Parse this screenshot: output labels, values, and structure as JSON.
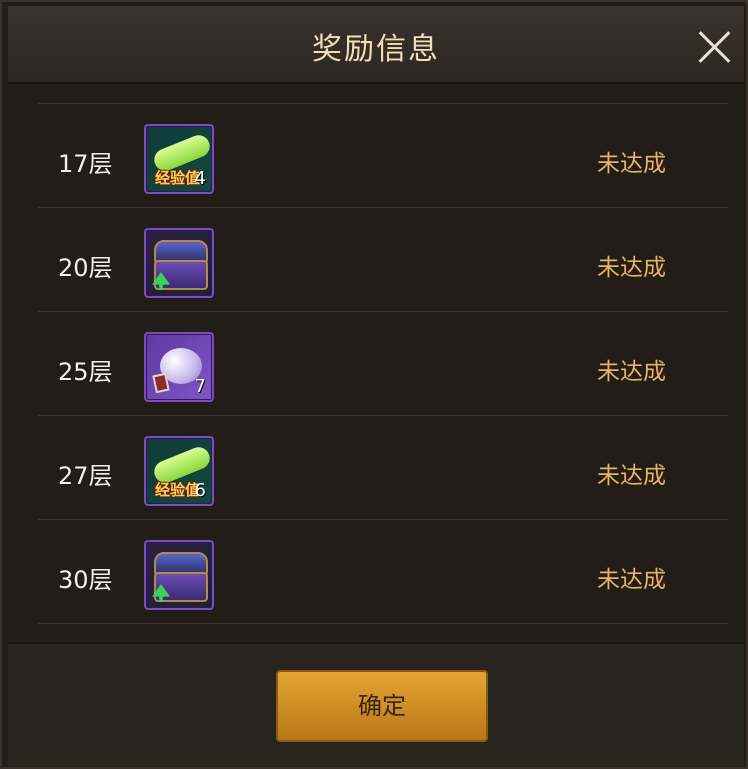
{
  "dialog": {
    "title": "奖励信息",
    "confirm_label": "确定"
  },
  "rows": [
    {
      "floor": "17层",
      "status": "未达成",
      "item": {
        "icon": "exp-scroll-icon",
        "label": "经验值",
        "qty": "4"
      }
    },
    {
      "floor": "20层",
      "status": "未达成",
      "item": {
        "icon": "treasure-chest-icon"
      }
    },
    {
      "floor": "25层",
      "status": "未达成",
      "item": {
        "icon": "teapot-icon",
        "qty": "7"
      }
    },
    {
      "floor": "27层",
      "status": "未达成",
      "item": {
        "icon": "exp-scroll-icon",
        "label": "经验值",
        "qty": "6"
      }
    },
    {
      "floor": "30层",
      "status": "未达成",
      "item": {
        "icon": "treasure-chest-icon"
      }
    }
  ],
  "colors": {
    "status": "#e7b35f",
    "button": "#d89b2a",
    "item_border": "#7a4bc2"
  }
}
